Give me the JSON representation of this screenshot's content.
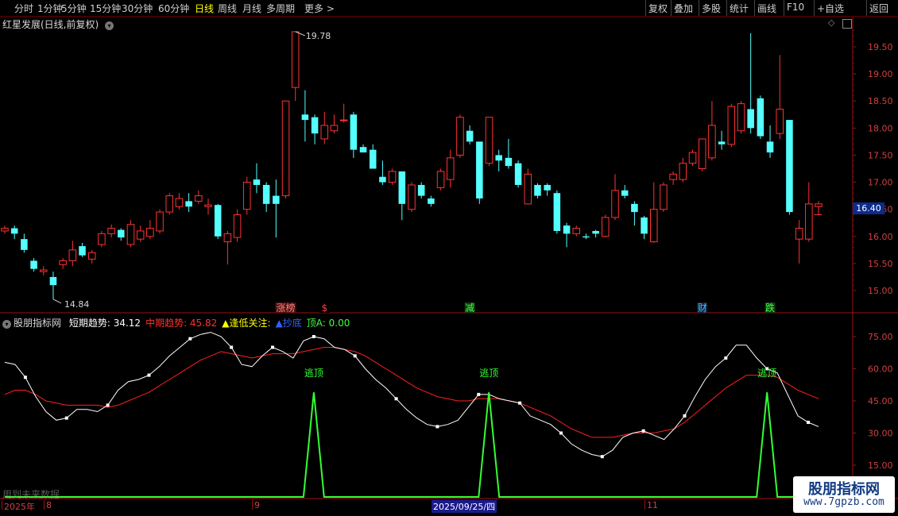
{
  "toolbar": {
    "left_items": [
      {
        "label": "分时",
        "active": false
      },
      {
        "label": "1分钟",
        "active": false
      },
      {
        "label": "5分钟",
        "active": false
      },
      {
        "label": "15分钟",
        "active": false
      },
      {
        "label": "30分钟",
        "active": false
      },
      {
        "label": "60分钟",
        "active": false
      },
      {
        "label": "日线",
        "active": true
      },
      {
        "label": "周线",
        "active": false
      },
      {
        "label": "月线",
        "active": false
      },
      {
        "label": "多周期",
        "active": false
      },
      {
        "label": "更多 >",
        "active": false
      }
    ],
    "right_items": [
      "复权",
      "叠加",
      "多股",
      "统计",
      "画线",
      "F10",
      "+自选",
      "返回"
    ]
  },
  "main_panel": {
    "title": "红星发展(日线,前复权)",
    "high_marker": "19.78",
    "low_marker": "14.84",
    "current_price": "16.40",
    "y_ticks": [
      "19.50",
      "19.00",
      "18.50",
      "18.00",
      "17.50",
      "17.00",
      "16.50",
      "16.00",
      "15.50",
      "15.00"
    ],
    "event_tags": [
      {
        "text": "涨榜",
        "color": "#ff8080",
        "bg": "#4a1010"
      },
      {
        "text": "$",
        "color": "#ff4040",
        "bg": "#000000"
      },
      {
        "text": "减",
        "color": "#40ff40",
        "bg": "#103a10"
      },
      {
        "text": "财",
        "color": "#40c0ff",
        "bg": "#10203a"
      },
      {
        "text": "跌",
        "color": "#40ff40",
        "bg": "#103a10"
      }
    ]
  },
  "indicator_panel": {
    "name": "股朋指标网",
    "legend": [
      {
        "text": "短期趋势: 34.12",
        "color": "#ffffff"
      },
      {
        "text": "中期趋势: 45.82",
        "color": "#ff3030"
      },
      {
        "text": "▲逢低关注:",
        "color": "#ffff00"
      },
      {
        "text": "▲抄底",
        "color": "#3060ff"
      },
      {
        "text": "顶A: 0.00",
        "color": "#40ff40"
      }
    ],
    "y_ticks": [
      "75.00",
      "60.00",
      "45.00",
      "30.00",
      "15.00"
    ],
    "signal_label": "逃顶",
    "footer_note": "用到未来数据"
  },
  "date_axis": {
    "labels": [
      "2025年",
      "8",
      "9",
      "2025/09/25/四",
      "11"
    ]
  },
  "watermark": {
    "line1": "股朋指标网",
    "line2": "www.7gpzb.com"
  },
  "colors": {
    "up": "#ff3232",
    "down": "#54ffff",
    "short_trend": "#ffffff",
    "mid_trend": "#ff2020",
    "signal": "#33ff33",
    "axis": "#d04040"
  },
  "chart_data": [
    {
      "type": "candlestick",
      "title": "红星发展(日线,前复权)",
      "ylim": [
        14.7,
        19.95
      ],
      "candles": [
        [
          16.1,
          16.15,
          16.2,
          16.05
        ],
        [
          16.15,
          16.05,
          16.2,
          15.95
        ],
        [
          15.95,
          15.75,
          16.05,
          15.7
        ],
        [
          15.55,
          15.4,
          15.6,
          15.35
        ],
        [
          15.35,
          15.38,
          15.45,
          15.28
        ],
        [
          15.25,
          15.1,
          15.35,
          14.84
        ],
        [
          15.48,
          15.55,
          15.6,
          15.4
        ],
        [
          15.55,
          15.75,
          15.92,
          15.45
        ],
        [
          15.82,
          15.65,
          15.88,
          15.62
        ],
        [
          15.58,
          15.7,
          15.75,
          15.5
        ],
        [
          15.85,
          16.05,
          16.1,
          15.8
        ],
        [
          16.05,
          16.15,
          16.22,
          15.98
        ],
        [
          16.12,
          15.98,
          16.15,
          15.92
        ],
        [
          15.85,
          16.22,
          16.3,
          15.8
        ],
        [
          15.95,
          16.1,
          16.2,
          15.9
        ],
        [
          16.0,
          16.15,
          16.3,
          15.95
        ],
        [
          16.1,
          16.45,
          16.5,
          16.05
        ],
        [
          16.45,
          16.75,
          16.8,
          16.4
        ],
        [
          16.55,
          16.7,
          16.8,
          16.5
        ],
        [
          16.65,
          16.55,
          16.8,
          16.45
        ],
        [
          16.65,
          16.75,
          16.85,
          16.6
        ],
        [
          16.55,
          16.58,
          16.7,
          16.4
        ],
        [
          16.58,
          16.0,
          16.6,
          15.95
        ],
        [
          15.9,
          16.05,
          16.1,
          15.48
        ],
        [
          15.98,
          16.4,
          16.5,
          15.9
        ],
        [
          16.5,
          17.0,
          17.1,
          16.4
        ],
        [
          17.05,
          16.95,
          17.35,
          16.8
        ],
        [
          16.95,
          16.6,
          17.0,
          16.45
        ],
        [
          16.75,
          16.6,
          17.05,
          15.98
        ],
        [
          16.75,
          18.5,
          18.5,
          16.7
        ],
        [
          18.75,
          19.78,
          19.78,
          18.5
        ],
        [
          18.25,
          18.15,
          18.7,
          17.75
        ],
        [
          18.2,
          17.9,
          18.25,
          17.7
        ],
        [
          17.8,
          18.05,
          18.3,
          17.7
        ],
        [
          17.95,
          18.05,
          18.25,
          17.9
        ],
        [
          18.15,
          18.15,
          18.45,
          18.1
        ],
        [
          18.25,
          17.6,
          18.3,
          17.45
        ],
        [
          17.65,
          17.55,
          17.7,
          17.55
        ],
        [
          17.6,
          17.25,
          17.7,
          17.25
        ],
        [
          17.1,
          17.0,
          17.4,
          16.95
        ],
        [
          17.0,
          17.2,
          17.25,
          16.95
        ],
        [
          17.2,
          16.6,
          17.2,
          16.3
        ],
        [
          16.5,
          16.95,
          17.0,
          16.45
        ],
        [
          16.95,
          16.75,
          17.0,
          16.7
        ],
        [
          16.7,
          16.6,
          16.75,
          16.55
        ],
        [
          16.9,
          17.2,
          17.25,
          16.85
        ],
        [
          17.05,
          17.45,
          17.6,
          16.9
        ],
        [
          17.5,
          18.2,
          18.25,
          17.45
        ],
        [
          17.95,
          17.75,
          18.05,
          17.7
        ],
        [
          17.75,
          16.7,
          17.75,
          16.6
        ],
        [
          17.35,
          18.2,
          18.2,
          17.3
        ],
        [
          17.5,
          17.4,
          17.6,
          17.2
        ],
        [
          17.45,
          17.3,
          17.8,
          17.25
        ],
        [
          17.35,
          16.95,
          17.4,
          16.9
        ],
        [
          16.6,
          17.15,
          17.25,
          16.6
        ],
        [
          16.95,
          16.75,
          16.98,
          16.7
        ],
        [
          16.95,
          16.85,
          16.98,
          16.75
        ],
        [
          16.8,
          16.1,
          16.85,
          16.05
        ],
        [
          16.2,
          16.05,
          16.25,
          15.8
        ],
        [
          16.05,
          16.15,
          16.2,
          16.0
        ],
        [
          16.0,
          15.98,
          16.05,
          15.95
        ],
        [
          16.1,
          16.05,
          16.12,
          15.98
        ],
        [
          16.0,
          16.35,
          16.4,
          15.98
        ],
        [
          16.35,
          16.85,
          17.15,
          16.3
        ],
        [
          16.85,
          16.75,
          16.95,
          16.7
        ],
        [
          16.6,
          16.45,
          16.65,
          16.2
        ],
        [
          16.35,
          16.05,
          16.38,
          15.95
        ],
        [
          15.9,
          16.5,
          17.0,
          15.88
        ],
        [
          16.5,
          16.95,
          17.0,
          16.45
        ],
        [
          17.05,
          17.15,
          17.2,
          16.95
        ],
        [
          17.05,
          17.35,
          17.45,
          17.0
        ],
        [
          17.35,
          17.55,
          17.6,
          17.3
        ],
        [
          17.25,
          17.8,
          17.8,
          17.2
        ],
        [
          17.45,
          18.05,
          18.5,
          17.4
        ],
        [
          17.75,
          17.7,
          17.95,
          17.6
        ],
        [
          17.7,
          18.4,
          18.45,
          17.65
        ],
        [
          17.95,
          18.45,
          18.5,
          17.9
        ],
        [
          18.35,
          18.0,
          19.75,
          17.9
        ],
        [
          18.55,
          17.85,
          18.6,
          17.8
        ],
        [
          17.75,
          17.55,
          18.05,
          17.45
        ],
        [
          17.9,
          18.35,
          19.35,
          17.8
        ],
        [
          18.15,
          16.45,
          18.15,
          16.4
        ],
        [
          15.95,
          16.15,
          16.3,
          15.5
        ],
        [
          15.95,
          16.6,
          17.0,
          15.9
        ],
        [
          16.55,
          16.6,
          16.65,
          16.4
        ]
      ]
    },
    {
      "type": "line",
      "ylim": [
        10,
        80
      ],
      "series": [
        {
          "name": "短期趋势",
          "color": "#ffffff",
          "values": [
            63,
            62,
            56,
            47,
            40,
            36,
            37,
            41,
            41,
            40,
            43,
            50,
            54,
            55,
            57,
            61,
            66,
            70,
            74,
            76,
            77,
            75,
            70,
            62,
            61,
            66,
            70,
            68,
            65,
            73,
            75,
            74,
            70,
            69,
            66,
            60,
            55,
            51,
            46,
            41,
            37,
            34,
            33,
            34,
            36,
            42,
            48,
            48,
            46,
            45,
            44,
            38,
            36,
            34,
            30,
            25,
            22,
            20,
            19,
            22,
            28,
            30,
            31,
            29,
            27,
            32,
            38,
            47,
            55,
            61,
            65,
            71,
            71,
            65,
            60,
            58,
            48,
            38,
            35,
            33
          ]
        },
        {
          "name": "中期趋势",
          "color": "#ff2020",
          "values": [
            48,
            50,
            50,
            48,
            45,
            44,
            43,
            43,
            43,
            43,
            42,
            43,
            45,
            47,
            49,
            52,
            55,
            58,
            61,
            64,
            66,
            68,
            67,
            66,
            65,
            66,
            67,
            67,
            67,
            68,
            69,
            70,
            70,
            69,
            68,
            66,
            63,
            60,
            57,
            54,
            51,
            49,
            47,
            46,
            45,
            45,
            46,
            46,
            46,
            45,
            44,
            42,
            40,
            38,
            35,
            32,
            30,
            28,
            28,
            28,
            29,
            30,
            30,
            30,
            31,
            32,
            35,
            39,
            43,
            47,
            51,
            54,
            57,
            57,
            57,
            56,
            53,
            50,
            48,
            46
          ]
        },
        {
          "name": "逃顶",
          "color": "#33ff33",
          "values": [
            0,
            0,
            0,
            0,
            0,
            0,
            0,
            0,
            0,
            0,
            0,
            0,
            0,
            0,
            0,
            0,
            0,
            0,
            0,
            0,
            0,
            0,
            0,
            0,
            0,
            0,
            0,
            0,
            0,
            0,
            1,
            0,
            0,
            0,
            0,
            0,
            0,
            0,
            0,
            0,
            0,
            0,
            0,
            0,
            0,
            0,
            0,
            1,
            0,
            0,
            0,
            0,
            0,
            0,
            0,
            0,
            0,
            0,
            0,
            0,
            0,
            0,
            0,
            0,
            0,
            0,
            0,
            0,
            0,
            0,
            0,
            0,
            0,
            0,
            1,
            0,
            0,
            0,
            0,
            0
          ]
        }
      ]
    }
  ]
}
